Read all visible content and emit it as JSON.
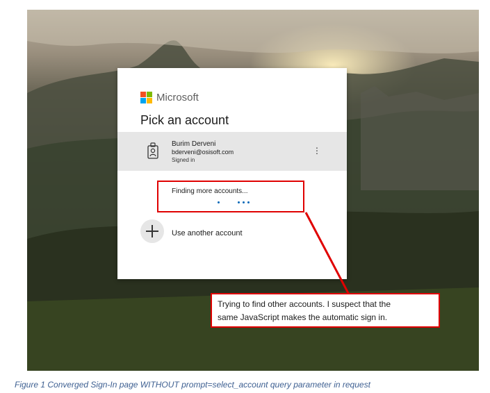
{
  "login": {
    "brand_name": "Microsoft",
    "title": "Pick an account",
    "account": {
      "name": "Burim Derveni",
      "email": "bderveni@osisoft.com",
      "status": "Signed in",
      "menu_icon": "more-options-icon"
    },
    "finding_text": "Finding more accounts...",
    "use_another_label": "Use another account",
    "logo_colors": [
      "#f25022",
      "#7fba00",
      "#00a4ef",
      "#ffb900"
    ]
  },
  "annotation": {
    "callout_line1": "Trying to find other accounts. I suspect that the",
    "callout_line2": "same JavaScript makes the automatic sign in.",
    "highlight_color": "#e00000"
  },
  "caption": "Figure 1 Converged Sign-In page WITHOUT prompt=select_account query parameter in request"
}
